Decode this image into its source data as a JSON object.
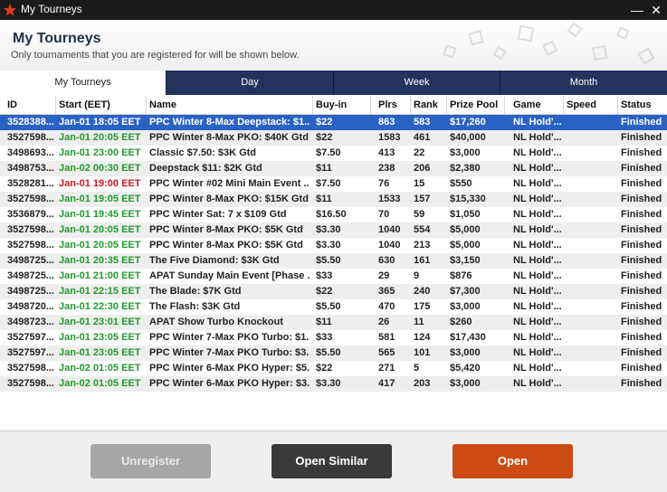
{
  "window": {
    "title": "My Tourneys",
    "minimize_symbol": "—",
    "close_symbol": "✕"
  },
  "header": {
    "title": "My Tourneys",
    "subtitle": "Only tournaments that you are registered for will be shown below."
  },
  "tabs": [
    {
      "label": "My Tourneys",
      "active": true
    },
    {
      "label": "Day",
      "active": false
    },
    {
      "label": "Week",
      "active": false
    },
    {
      "label": "Month",
      "active": false
    }
  ],
  "columns": [
    "ID",
    "Start (EET)",
    "Name",
    "Buy-in",
    "Plrs",
    "Rank",
    "Prize Pool",
    "Game",
    "Speed",
    "Status"
  ],
  "colors": {
    "accent": "#2a62c4",
    "start_upcoming": "#1f9a2c",
    "start_alert": "#d0161b",
    "tab_bar": "#23345c",
    "open_button": "#cc4a13"
  },
  "rows": [
    {
      "id": "3528388...",
      "start": "Jan-01 18:05 EET",
      "start_color": "green",
      "name": "PPC Winter 8-Max Deepstack: $1...",
      "buyin": "$22",
      "plrs": "863",
      "rank": "583",
      "prize": "$17,260",
      "game": "NL Hold'...",
      "speed": "",
      "status": "Finished",
      "selected": true
    },
    {
      "id": "3527598...",
      "start": "Jan-01 20:05 EET",
      "start_color": "green",
      "name": "PPC Winter 8-Max PKO: $40K Gtd",
      "buyin": "$22",
      "plrs": "1583",
      "rank": "461",
      "prize": "$40,000",
      "game": "NL Hold'...",
      "speed": "",
      "status": "Finished",
      "selected": false
    },
    {
      "id": "3498693...",
      "start": "Jan-01 23:00 EET",
      "start_color": "green",
      "name": "Classic $7.50: $3K Gtd",
      "buyin": "$7.50",
      "plrs": "413",
      "rank": "22",
      "prize": "$3,000",
      "game": "NL Hold'...",
      "speed": "",
      "status": "Finished",
      "selected": false
    },
    {
      "id": "3498753...",
      "start": "Jan-02 00:30 EET",
      "start_color": "green",
      "name": "Deepstack $11: $2K Gtd",
      "buyin": "$11",
      "plrs": "238",
      "rank": "206",
      "prize": "$2,380",
      "game": "NL Hold'...",
      "speed": "",
      "status": "Finished",
      "selected": false
    },
    {
      "id": "3528281...",
      "start": "Jan-01 19:00 EET",
      "start_color": "red",
      "name": "PPC Winter #02 Mini Main Event ...",
      "buyin": "$7.50",
      "plrs": "76",
      "rank": "15",
      "prize": "$550",
      "game": "NL Hold'...",
      "speed": "",
      "status": "Finished",
      "selected": false
    },
    {
      "id": "3527598...",
      "start": "Jan-01 19:05 EET",
      "start_color": "green",
      "name": "PPC Winter 8-Max PKO: $15K Gtd",
      "buyin": "$11",
      "plrs": "1533",
      "rank": "157",
      "prize": "$15,330",
      "game": "NL Hold'...",
      "speed": "",
      "status": "Finished",
      "selected": false
    },
    {
      "id": "3536879...",
      "start": "Jan-01 19:45 EET",
      "start_color": "green",
      "name": "PPC Winter Sat: 7 x $109 Gtd",
      "buyin": "$16.50",
      "plrs": "70",
      "rank": "59",
      "prize": "$1,050",
      "game": "NL Hold'...",
      "speed": "",
      "status": "Finished",
      "selected": false
    },
    {
      "id": "3527598...",
      "start": "Jan-01 20:05 EET",
      "start_color": "green",
      "name": "PPC Winter 8-Max PKO: $5K Gtd",
      "buyin": "$3.30",
      "plrs": "1040",
      "rank": "554",
      "prize": "$5,000",
      "game": "NL Hold'...",
      "speed": "",
      "status": "Finished",
      "selected": false
    },
    {
      "id": "3527598...",
      "start": "Jan-01 20:05 EET",
      "start_color": "green",
      "name": "PPC Winter 8-Max PKO: $5K Gtd",
      "buyin": "$3.30",
      "plrs": "1040",
      "rank": "213",
      "prize": "$5,000",
      "game": "NL Hold'...",
      "speed": "",
      "status": "Finished",
      "selected": false
    },
    {
      "id": "3498725...",
      "start": "Jan-01 20:35 EET",
      "start_color": "green",
      "name": "The Five Diamond: $3K Gtd",
      "buyin": "$5.50",
      "plrs": "630",
      "rank": "161",
      "prize": "$3,150",
      "game": "NL Hold'...",
      "speed": "",
      "status": "Finished",
      "selected": false
    },
    {
      "id": "3498725...",
      "start": "Jan-01 21:00 EET",
      "start_color": "green",
      "name": "APAT Sunday Main Event [Phase ...",
      "buyin": "$33",
      "plrs": "29",
      "rank": "9",
      "prize": "$876",
      "game": "NL Hold'...",
      "speed": "",
      "status": "Finished",
      "selected": false
    },
    {
      "id": "3498725...",
      "start": "Jan-01 22:15 EET",
      "start_color": "green",
      "name": "The Blade: $7K Gtd",
      "buyin": "$22",
      "plrs": "365",
      "rank": "240",
      "prize": "$7,300",
      "game": "NL Hold'...",
      "speed": "",
      "status": "Finished",
      "selected": false
    },
    {
      "id": "3498720...",
      "start": "Jan-01 22:30 EET",
      "start_color": "green",
      "name": "The Flash: $3K Gtd",
      "buyin": "$5.50",
      "plrs": "470",
      "rank": "175",
      "prize": "$3,000",
      "game": "NL Hold'...",
      "speed": "",
      "status": "Finished",
      "selected": false
    },
    {
      "id": "3498723...",
      "start": "Jan-01 23:01 EET",
      "start_color": "green",
      "name": "APAT Show Turbo Knockout",
      "buyin": "$11",
      "plrs": "26",
      "rank": "11",
      "prize": "$260",
      "game": "NL Hold'...",
      "speed": "",
      "status": "Finished",
      "selected": false
    },
    {
      "id": "3527597...",
      "start": "Jan-01 23:05 EET",
      "start_color": "green",
      "name": "PPC Winter 7-Max PKO Turbo: $1...",
      "buyin": "$33",
      "plrs": "581",
      "rank": "124",
      "prize": "$17,430",
      "game": "NL Hold'...",
      "speed": "",
      "status": "Finished",
      "selected": false
    },
    {
      "id": "3527597...",
      "start": "Jan-01 23:05 EET",
      "start_color": "green",
      "name": "PPC Winter 7-Max PKO Turbo: $3...",
      "buyin": "$5.50",
      "plrs": "565",
      "rank": "101",
      "prize": "$3,000",
      "game": "NL Hold'...",
      "speed": "",
      "status": "Finished",
      "selected": false
    },
    {
      "id": "3527598...",
      "start": "Jan-02 01:05 EET",
      "start_color": "green",
      "name": "PPC Winter 6-Max PKO Hyper: $5...",
      "buyin": "$22",
      "plrs": "271",
      "rank": "5",
      "prize": "$5,420",
      "game": "NL Hold'...",
      "speed": "",
      "status": "Finished",
      "selected": false
    },
    {
      "id": "3527598...",
      "start": "Jan-02 01:05 EET",
      "start_color": "green",
      "name": "PPC Winter 6-Max PKO Hyper: $3...",
      "buyin": "$3.30",
      "plrs": "417",
      "rank": "203",
      "prize": "$3,000",
      "game": "NL Hold'...",
      "speed": "",
      "status": "Finished",
      "selected": false
    }
  ],
  "footer": {
    "unregister_label": "Unregister",
    "open_similar_label": "Open Similar",
    "open_label": "Open"
  }
}
